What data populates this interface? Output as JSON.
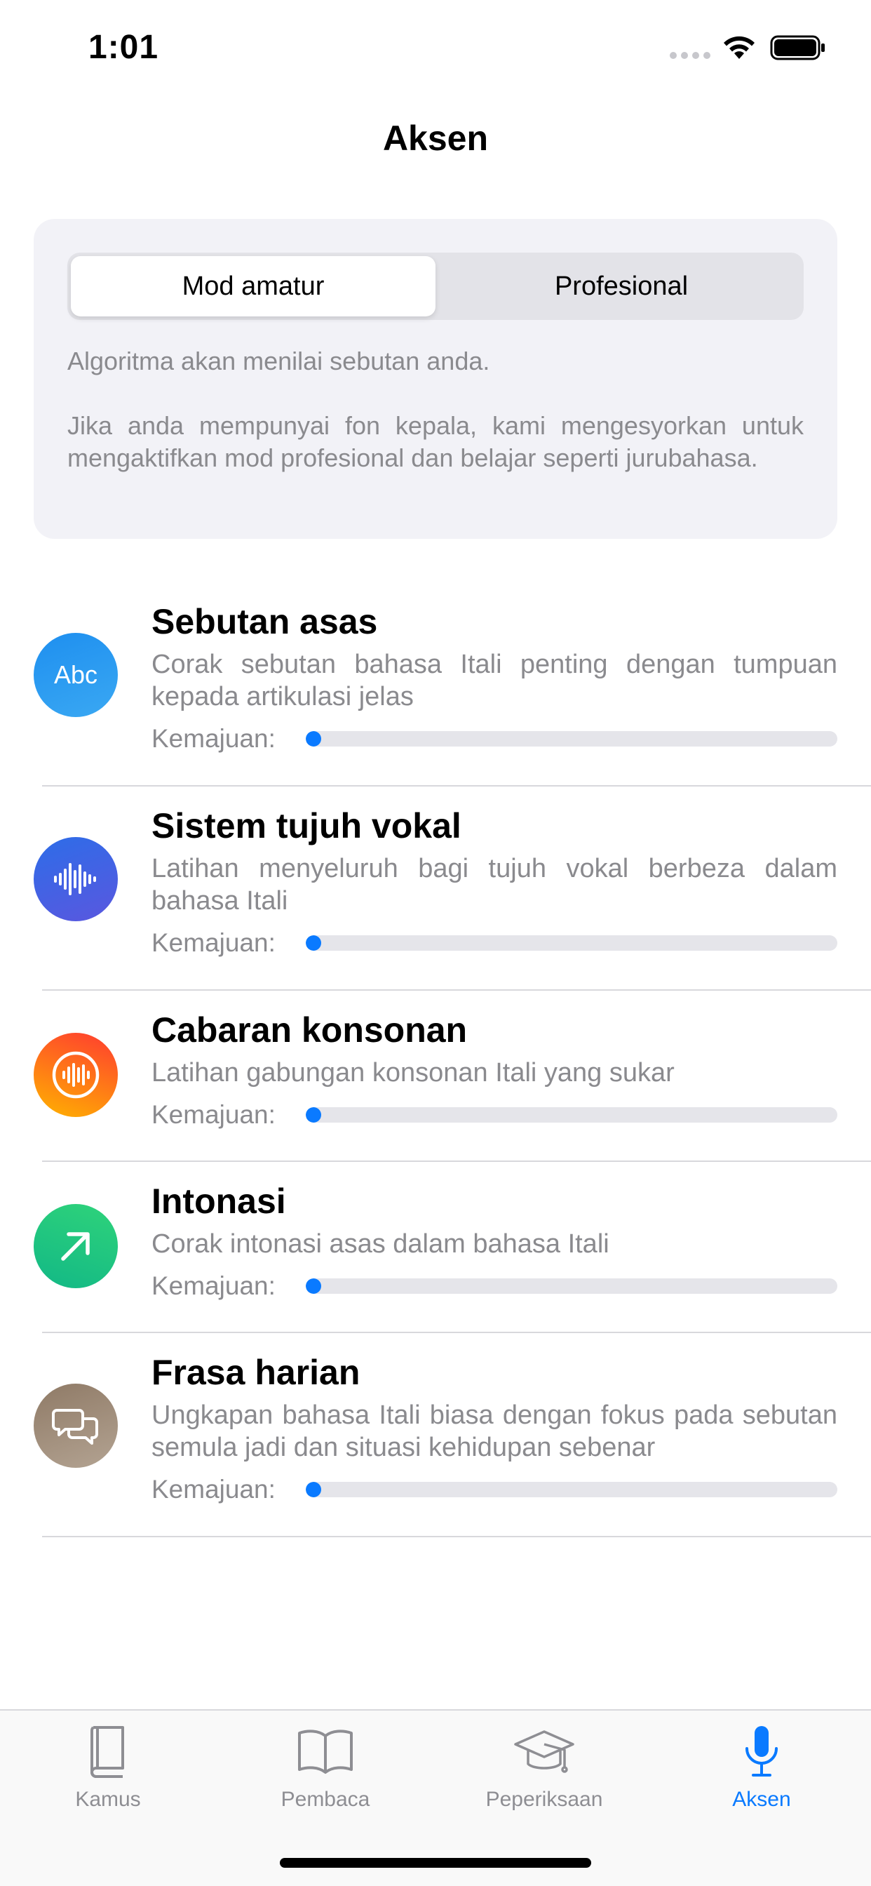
{
  "status": {
    "time": "1:01"
  },
  "nav": {
    "title": "Aksen"
  },
  "mode": {
    "segments": [
      "Mod amatur",
      "Profesional"
    ],
    "selected": "Mod amatur",
    "paragraph1": "Algoritma akan menilai sebutan anda.",
    "paragraph2": "Jika anda mempunyai fon kepala, kami mengesyorkan untuk mengaktifkan mod profesional dan belajar seperti jurubahasa."
  },
  "progress_label": "Kemajuan:",
  "lessons": [
    {
      "title": "Sebutan asas",
      "description": "Corak sebutan bahasa Itali penting dengan tumpuan kepada artikulasi jelas",
      "progress": 0.02,
      "icon": "abc-icon",
      "icon_text": "Abc",
      "colors": [
        "#1e8ff0",
        "#3aa8f2"
      ]
    },
    {
      "title": "Sistem tujuh vokal",
      "description": "Latihan menyeluruh bagi tujuh vokal berbeza dalam bahasa Itali",
      "progress": 0.02,
      "icon": "waveform-icon",
      "colors": [
        "#2d6de8",
        "#5a57df"
      ]
    },
    {
      "title": "Cabaran konsonan",
      "description": "Latihan gabungan konsonan Itali yang sukar",
      "progress": 0.02,
      "icon": "waveform-circle-icon",
      "colors": [
        "#ff3b30",
        "#ffb300"
      ]
    },
    {
      "title": "Intonasi",
      "description": "Corak intonasi asas dalam bahasa Itali",
      "progress": 0.02,
      "icon": "arrow-up-right-icon",
      "colors": [
        "#12b886",
        "#2fd37a"
      ]
    },
    {
      "title": "Frasa harian",
      "description": "Ungkapan bahasa Itali biasa dengan fokus pada sebutan semula jadi dan situasi kehidupan sebenar",
      "progress": 0.02,
      "icon": "chat-bubbles-icon",
      "colors": [
        "#8f7a66",
        "#b3a392"
      ]
    }
  ],
  "tabs": [
    {
      "label": "Kamus",
      "icon": "book-icon",
      "active": false
    },
    {
      "label": "Pembaca",
      "icon": "open-book-icon",
      "active": false
    },
    {
      "label": "Peperiksaan",
      "icon": "graduation-cap-icon",
      "active": false
    },
    {
      "label": "Aksen",
      "icon": "microphone-icon",
      "active": true
    }
  ],
  "colors": {
    "accent": "#0a7aff",
    "secondary_text": "#8a8a8e",
    "card_bg": "#f2f2f7"
  }
}
